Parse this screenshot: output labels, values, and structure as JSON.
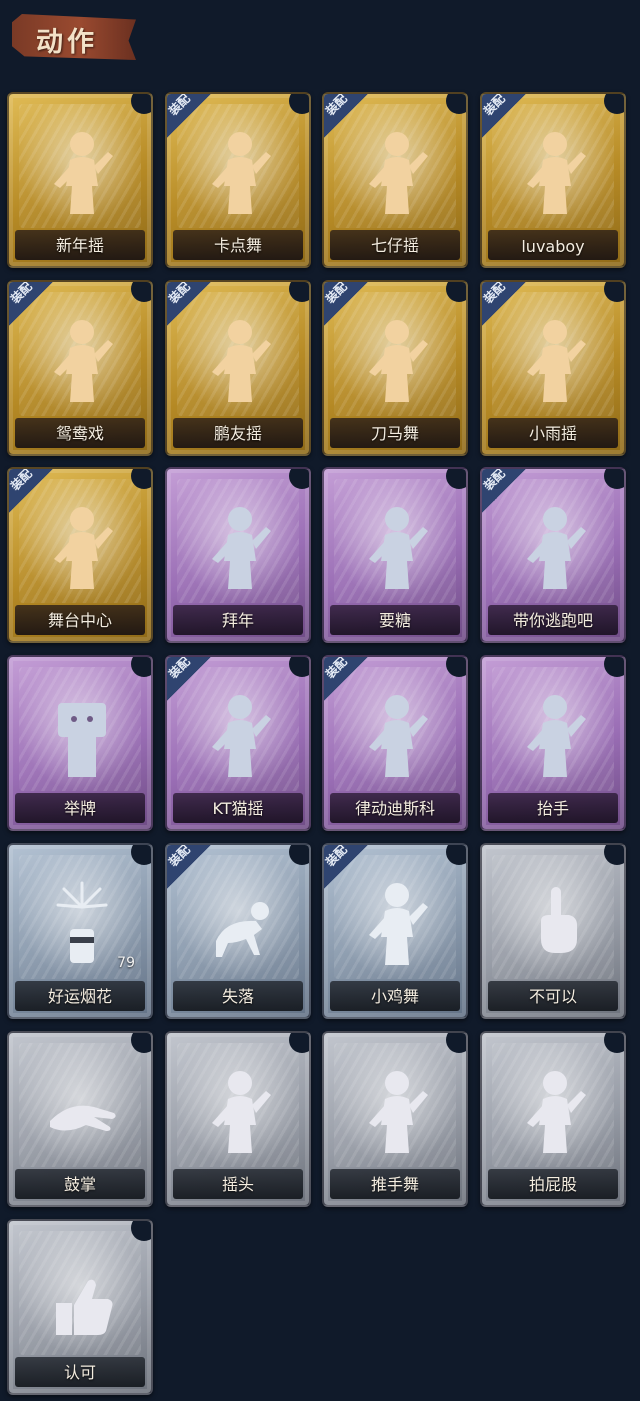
{
  "header": {
    "title": "动作"
  },
  "equip_label": "装配",
  "palette": {
    "gold": "#c99b33",
    "purple": "#9a6eb5",
    "blue": "#8898ab",
    "grey": "#979ca6",
    "figure_gold": "#f2d2a0",
    "figure_purple": "#c9d2e2",
    "figure_blue": "#e8edf3",
    "figure_grey": "#e8e8ef",
    "equip_tag": "#2f4470"
  },
  "cards": [
    {
      "name": "新年摇",
      "rarity": "gold",
      "equipped": false,
      "icon": "dancer-swing-icon"
    },
    {
      "name": "卡点舞",
      "rarity": "gold",
      "equipped": true,
      "icon": "dancer-point-up-icon"
    },
    {
      "name": "七仔摇",
      "rarity": "gold",
      "equipped": true,
      "icon": "dancer-arms-cross-icon"
    },
    {
      "name": "luvaboy",
      "rarity": "gold",
      "equipped": true,
      "icon": "dancer-groove-icon"
    },
    {
      "name": "鸳鸯戏",
      "rarity": "gold",
      "equipped": true,
      "icon": "dancer-music-icon"
    },
    {
      "name": "鹏友摇",
      "rarity": "gold",
      "equipped": true,
      "icon": "dancer-fists-icon"
    },
    {
      "name": "刀马舞",
      "rarity": "gold",
      "equipped": true,
      "icon": "dancer-blade-icon"
    },
    {
      "name": "小雨摇",
      "rarity": "gold",
      "equipped": true,
      "icon": "dancer-raise-icon"
    },
    {
      "name": "舞台中心",
      "rarity": "gold",
      "equipped": true,
      "icon": "dancer-center-stage-icon"
    },
    {
      "name": "拜年",
      "rarity": "purple",
      "equipped": false,
      "icon": "figure-bow-icon"
    },
    {
      "name": "要糖",
      "rarity": "purple",
      "equipped": false,
      "icon": "figure-ask-candy-icon"
    },
    {
      "name": "带你逃跑吧",
      "rarity": "purple",
      "equipped": true,
      "icon": "dancer-run-away-icon"
    },
    {
      "name": "举牌",
      "rarity": "purple",
      "equipped": false,
      "icon": "figure-hold-sign-icon"
    },
    {
      "name": "KT猫摇",
      "rarity": "purple",
      "equipped": true,
      "icon": "dancer-cat-shake-icon"
    },
    {
      "name": "律动迪斯科",
      "rarity": "purple",
      "equipped": true,
      "icon": "dancer-disco-icon"
    },
    {
      "name": "抬手",
      "rarity": "purple",
      "equipped": false,
      "icon": "figure-raise-hand-icon"
    },
    {
      "name": "好运烟花",
      "rarity": "blue",
      "equipped": false,
      "icon": "firework-icon",
      "count": "79"
    },
    {
      "name": "失落",
      "rarity": "blue",
      "equipped": true,
      "icon": "figure-crawl-icon"
    },
    {
      "name": "小鸡舞",
      "rarity": "blue",
      "equipped": true,
      "icon": "figure-chicken-dance-icon"
    },
    {
      "name": "不可以",
      "rarity": "grey",
      "equipped": false,
      "icon": "finger-wag-icon"
    },
    {
      "name": "鼓掌",
      "rarity": "grey",
      "equipped": false,
      "icon": "clap-hands-icon"
    },
    {
      "name": "摇头",
      "rarity": "grey",
      "equipped": false,
      "icon": "figure-shake-head-icon"
    },
    {
      "name": "推手舞",
      "rarity": "grey",
      "equipped": false,
      "icon": "figure-push-hands-icon"
    },
    {
      "name": "拍屁股",
      "rarity": "grey",
      "equipped": false,
      "icon": "figure-pat-butt-icon"
    },
    {
      "name": "认可",
      "rarity": "grey",
      "equipped": false,
      "icon": "thumbs-up-icon"
    }
  ]
}
